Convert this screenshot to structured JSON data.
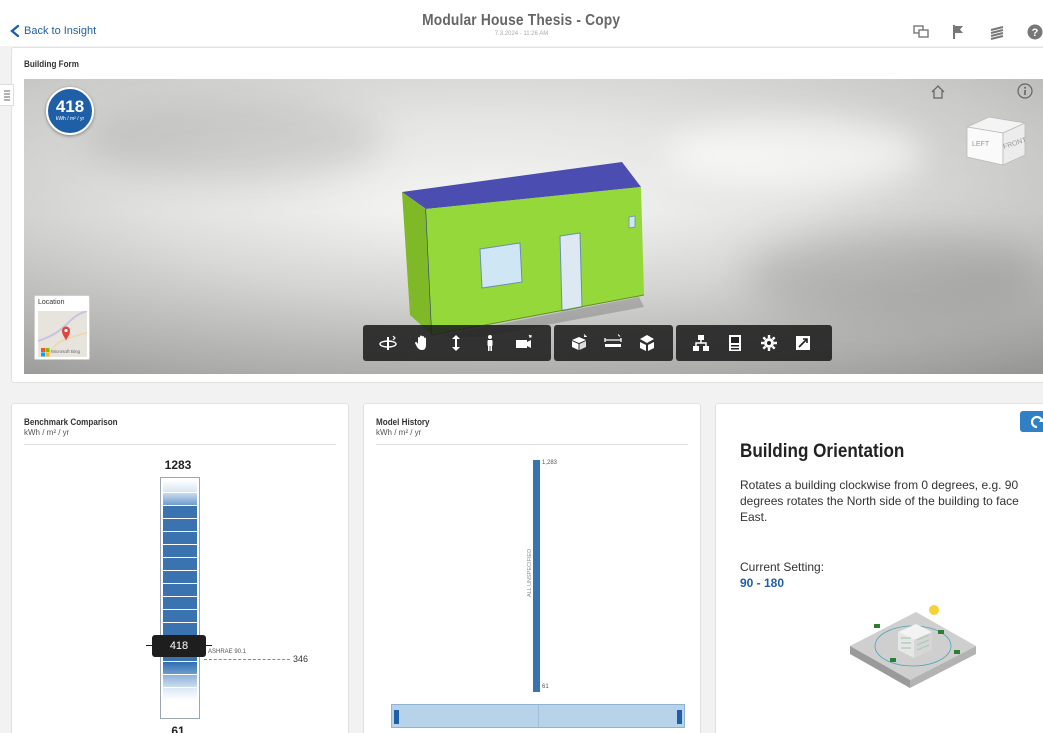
{
  "header": {
    "back_label": "Back to Insight",
    "title": "Modular House Thesis - Copy",
    "subtitle": "7.3.2024 - 11:26 AM",
    "icons": [
      "compare-icon",
      "flag-icon",
      "layers-icon",
      "help-icon"
    ]
  },
  "building_form": {
    "title": "Building Form",
    "eui_value": "418",
    "eui_unit": "kWh / m² / yr",
    "location_label": "Location",
    "map_brand": "Microsoft Bing",
    "viewcube_faces": [
      "LEFT",
      "FRONT"
    ],
    "toolbar_groups": [
      [
        "orbit-icon",
        "pan-icon",
        "zoom-icon",
        "walk-icon",
        "camera-icon"
      ],
      [
        "model-icon",
        "measure-icon",
        "explode-icon"
      ],
      [
        "structure-icon",
        "properties-icon",
        "settings-icon",
        "fullscreen-icon"
      ]
    ]
  },
  "benchmark": {
    "title": "Benchmark Comparison",
    "units": "kWh / m² / yr",
    "max": "1283",
    "min": "61",
    "current": "418",
    "ashrae_label": "ASHRAE 90.1",
    "ashrae_value": "346"
  },
  "model_history": {
    "title": "Model History",
    "units": "kWh / m² / yr",
    "top_label": "1,283",
    "bottom_label": "61",
    "bar_label": "ALL UNSPECIFIED"
  },
  "orientation": {
    "title": "Building Orientation",
    "description": "Rotates a building clockwise from 0 degrees, e.g. 90 degrees rotates the North side of the building to face East.",
    "current_label": "Current Setting:",
    "current_value": "90 - 180"
  },
  "colors": {
    "accent": "#1f5fa8",
    "house_wall": "#8fd22f",
    "house_roof": "#4b4db0",
    "bar_blue": "#3a73b0"
  }
}
